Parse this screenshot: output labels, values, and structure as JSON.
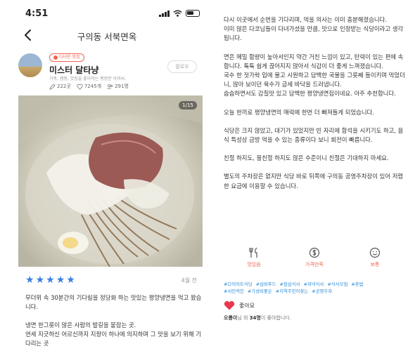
{
  "status_bar": {
    "time": "4:51"
  },
  "nav": {
    "title": "구의동 서북면옥"
  },
  "profile": {
    "badge": "다녀온 맛집",
    "nickname": "미스터 달타냥",
    "bio": "가족, 캠핑, 맛집을 좋아하는 평범한 아저씨.",
    "follow_label": "팔로우",
    "stats": {
      "reviews": "222곳",
      "likes": "7245개",
      "photos": "291명"
    }
  },
  "photo": {
    "counter": "1/15",
    "colors": {
      "broth": "#d9d6c8",
      "beef": "#9c5a55",
      "noodles": "#8a6a4a",
      "egg": "#f4d98a"
    }
  },
  "rating": {
    "stars": 5,
    "visit_date": "4월 전"
  },
  "review_left": [
    "무더위 속 30분간의 기다림을 정당화 하는 맛있는 평양냉면을 먹고 왔습니다.",
    "냉면 한그릇이 많은 사람의 발길을 붙잡는 곳.\n연세 지긋하신 어르신까지 지팡이 하나에 의지하며 그 맛을 보기 위해 기다리는 곳"
  ],
  "review_right": [
    "다시 이곳에서 순번을 기다리며, 먹을 의사는 이미 충분해졌습니다.\n이미 많은 다코님들이 다녀가셨을 만큼, 맛으로 인정받는 식당이라고 생각됩니다.",
    "면은 메밀 함량이 높아서인지 약간 거친 느낌이 있고, 탄력이 있는 편에 속합니다. 툭툭 쉽게 끊어지지 않아서 식감이 더 좋게 느껴졌습니다.\n국수 한 젓가락 입에 물고 시원하고 담백한 국물을 그릇째 들이키며 먹었더니, 많아 보이던 육수가 금세 바닥을 드러냅니다.\n슴슴하면서도 감칠맛 있고 담백한 평양냉면집이네요. 아주 추천합니다.",
    "오늘 한끼로 평양냉면의 매력에 한번 더 빠져들게 되었습니다.",
    "식당은 크지 않았고, 대기가 있었지만 빈 자리에 합석을 시키기도 하고, 음식 특성상 금방 먹을 수 있는 종류이다 보니 회전이 빠릅니다.",
    "친절 하지도, 불친절 하지도 않은 수준이니 친절은 기대하지 마세요.",
    "별도의 주차장은 없지만 식당 바로 뒤쪽에 구의동 공영주차장이 있어 저렴한 요금에 이용할 수 있습니다."
  ],
  "actions": [
    {
      "icon": "utensils-icon",
      "label": "맛있음"
    },
    {
      "icon": "dollar-icon",
      "label": "가격만족"
    },
    {
      "icon": "smile-icon",
      "label": "보통"
    }
  ],
  "tags": [
    "#다이어트식당",
    "#심버푸드",
    "#점심식사",
    "#저녁식사",
    "#식사모임",
    "#혼밥",
    "#서민적인",
    "#가성비좋은",
    "#지역주민이찾는",
    "#공영주차"
  ],
  "likes": {
    "label": "좋아요",
    "user": "오룡이",
    "count": "34명",
    "summary_suffix": "님 외",
    "summary_end": "이 좋아합니다."
  },
  "colors": {
    "accent": "#f2634f",
    "star": "#3b7fe0",
    "tag": "#2b8ad6",
    "heart": "#e8384f"
  }
}
